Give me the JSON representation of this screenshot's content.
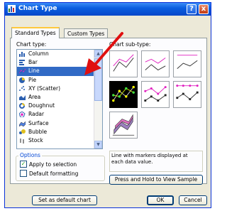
{
  "dialog": {
    "title": "Chart Type",
    "help_label": "?",
    "close_label": "x"
  },
  "tabs": [
    {
      "label": "Standard Types",
      "active": true
    },
    {
      "label": "Custom Types",
      "active": false
    }
  ],
  "chart_type": {
    "label": "Chart type:",
    "items": [
      {
        "label": "Column",
        "icon": "column-chart-icon"
      },
      {
        "label": "Bar",
        "icon": "bar-chart-icon"
      },
      {
        "label": "Line",
        "icon": "line-chart-icon",
        "selected": true
      },
      {
        "label": "Pie",
        "icon": "pie-chart-icon"
      },
      {
        "label": "XY (Scatter)",
        "icon": "scatter-chart-icon"
      },
      {
        "label": "Area",
        "icon": "area-chart-icon"
      },
      {
        "label": "Doughnut",
        "icon": "doughnut-chart-icon"
      },
      {
        "label": "Radar",
        "icon": "radar-chart-icon"
      },
      {
        "label": "Surface",
        "icon": "surface-chart-icon"
      },
      {
        "label": "Bubble",
        "icon": "bubble-chart-icon"
      },
      {
        "label": "Stock",
        "icon": "stock-chart-icon"
      }
    ]
  },
  "sub_type": {
    "label": "Chart sub-type:",
    "selected_index": 3,
    "description": "Line with markers displayed at each data value."
  },
  "options": {
    "label": "Options",
    "apply_to_selection": {
      "label": "Apply to selection",
      "checked": true
    },
    "default_formatting": {
      "label": "Default formatting",
      "checked": false
    }
  },
  "buttons": {
    "press_hold": "Press and Hold to View Sample",
    "set_default": "Set as default chart",
    "ok": "OK",
    "cancel": "Cancel"
  },
  "colors": {
    "title_bar": "#0a5ee0",
    "selection": "#316ac5",
    "annotation_arrow": "#e01010"
  }
}
